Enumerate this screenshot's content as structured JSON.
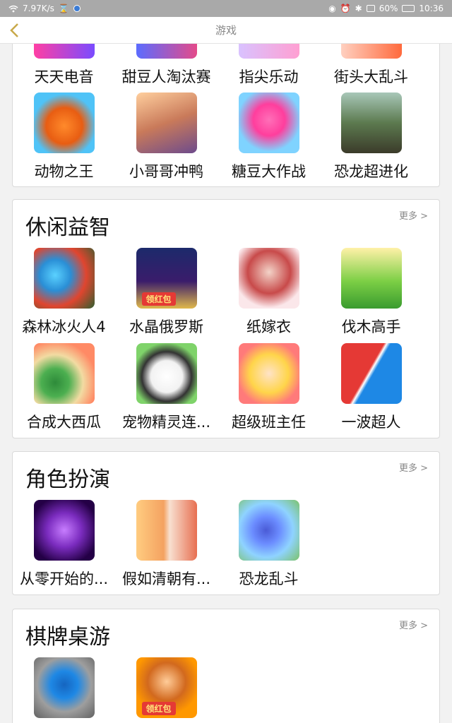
{
  "status_bar": {
    "speed": "7.97K/s",
    "battery": "60%",
    "time": "10:36"
  },
  "nav": {
    "title": "游戏",
    "back_icon": "chevron-left-icon",
    "back_color": "#c8a94a"
  },
  "top_section": {
    "row1": [
      "天天电音",
      "甜豆人淘汰赛",
      "指尖乐动",
      "街头大乱斗"
    ],
    "row2": [
      "动物之王",
      "小哥哥冲鸭",
      "糖豆大作战",
      "恐龙超进化"
    ]
  },
  "sections": [
    {
      "title": "休闲益智",
      "more": "更多 >",
      "apps": [
        "森林冰火人4",
        "水晶俄罗斯",
        "纸嫁衣",
        "伐木高手",
        "合成大西瓜",
        "宠物精灵连...",
        "超级班主任",
        "一波超人"
      ],
      "badges": {
        "1": "领红包"
      }
    },
    {
      "title": "角色扮演",
      "more": "更多 >",
      "apps": [
        "从零开始的...",
        "假如清朝有...",
        "恐龙乱斗"
      ]
    },
    {
      "title": "棋牌桌游",
      "more": "更多 >",
      "apps": [
        "",
        ""
      ],
      "badges": {
        "1": "领红包"
      }
    }
  ]
}
